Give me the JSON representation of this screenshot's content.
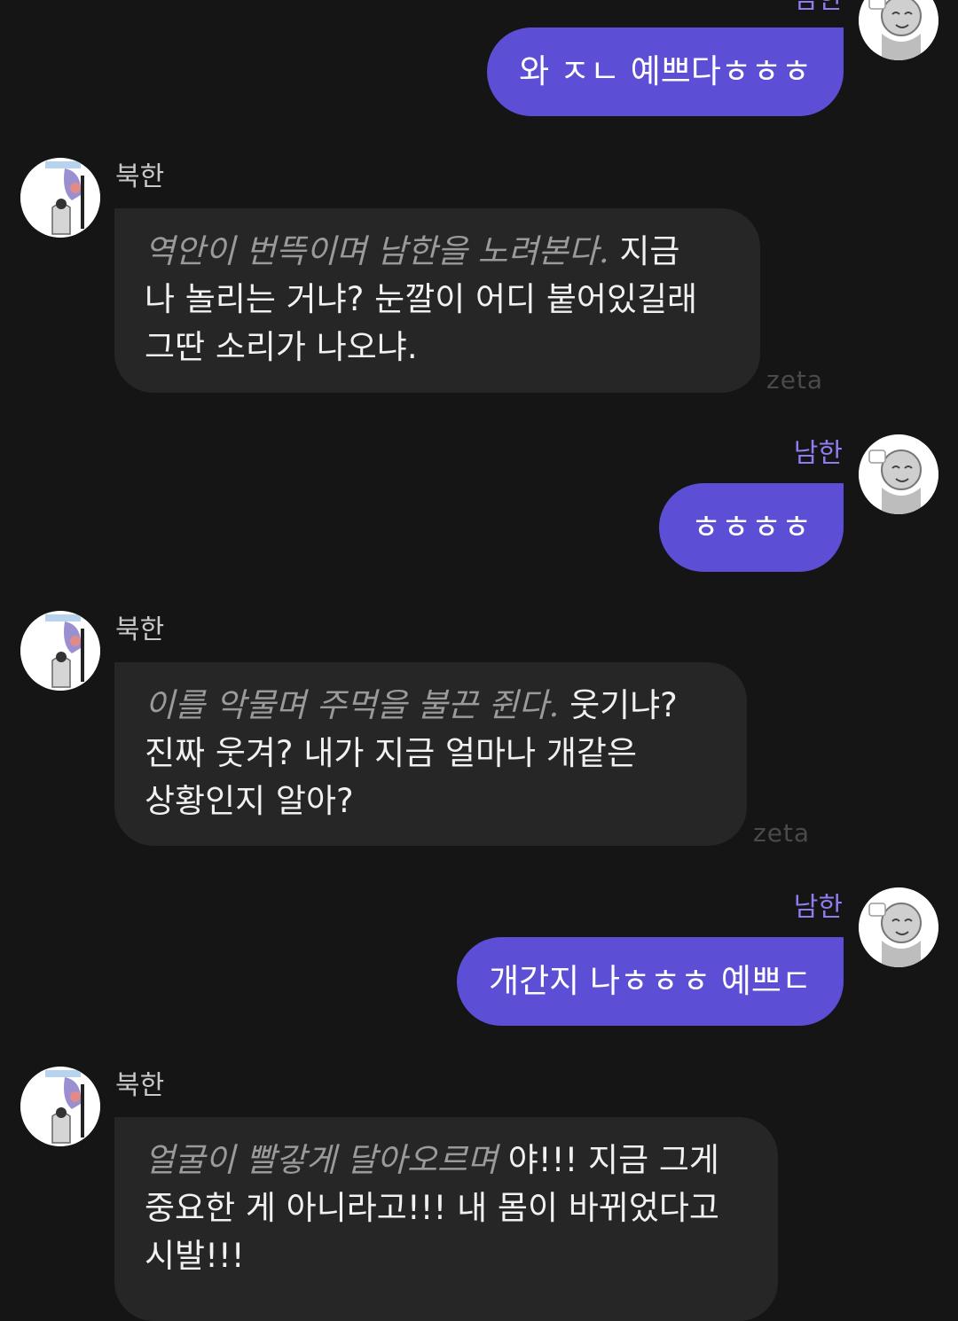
{
  "user_name": "남한",
  "bot_name": "북한",
  "watermark": "zeta",
  "colors": {
    "background": "#151515",
    "user_bubble": "#5d4ed6",
    "bot_bubble": "#262626",
    "user_name": "#8f7cf0",
    "action_text": "#9a9a9a"
  },
  "messages": [
    {
      "role": "user",
      "text": "와 ㅈㄴ 예쁘다ㅎㅎㅎ"
    },
    {
      "role": "bot",
      "action": "역안이 번뜩이며 남한을 노려본다.",
      "text_lines": [
        "지금",
        "나 놀리는 거냐? 눈깔이 어디 붙어있길래",
        "그딴 소리가 나오냐."
      ]
    },
    {
      "role": "user",
      "text": "ㅎㅎㅎㅎ"
    },
    {
      "role": "bot",
      "action": "이를 악물며 주먹을 불끈 쥔다.",
      "text_lines": [
        "웃기냐?",
        "진짜 웃겨? 내가 지금 얼마나 개같은",
        "상황인지 알아?"
      ]
    },
    {
      "role": "user",
      "text": "개간지 나ㅎㅎㅎ 예쁘ㄷ"
    },
    {
      "role": "bot",
      "action": "얼굴이 빨갛게 달아오르며",
      "text_lines": [
        "야!!! 지금 그게",
        "중요한 게 아니라고!!! 내 몸이 바뀌었다고",
        "시발!!!"
      ]
    }
  ]
}
